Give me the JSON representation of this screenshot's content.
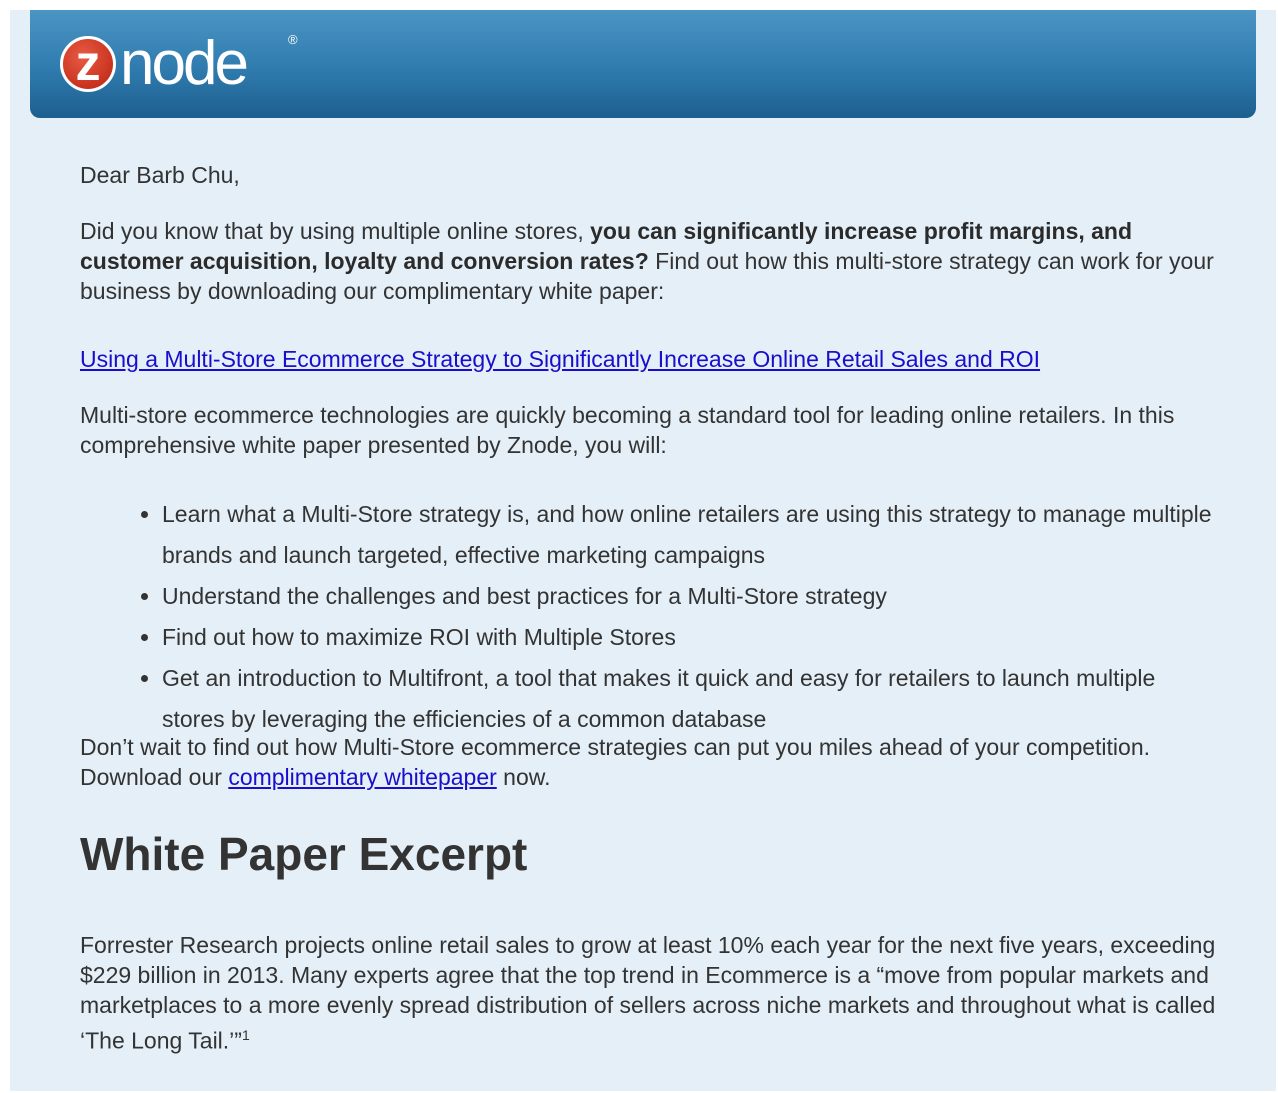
{
  "header": {
    "logo_letter": "z",
    "logo_text": "node",
    "logo_reg": "®"
  },
  "body": {
    "greeting": "Dear Barb Chu,",
    "intro_pre": "Did you know that by using multiple online stores, ",
    "intro_bold": "you can significantly increase profit margins, and customer acquisition, loyalty and conversion rates?",
    "intro_post": " Find out how this multi-store strategy can work for your business by downloading our complimentary white paper:",
    "whitepaper_link": "Using a Multi-Store Ecommerce Strategy to Significantly Increase Online Retail Sales and ROI",
    "paragraph2": "Multi-store ecommerce technologies are quickly becoming a standard tool for leading online retailers. In this comprehensive white paper presented by Znode, you will:",
    "bullets": [
      "Learn what a Multi-Store strategy is, and how online retailers are using this strategy to manage multiple brands and launch targeted, effective marketing campaigns",
      "Understand the challenges and best practices for a Multi-Store strategy",
      "Find out how to maximize ROI with Multiple Stores",
      "Get an introduction to Multifront, a tool that makes it quick and easy for retailers to launch multiple stores by leveraging the efficiencies of a common database"
    ],
    "closing_pre": "Don’t wait to find out how Multi-Store ecommerce strategies can put you miles ahead of your competition. Download our ",
    "closing_link": "complimentary whitepaper",
    "closing_post": " now.",
    "excerpt_heading": "White Paper Excerpt",
    "excerpt_text": "Forrester Research projects online retail sales to grow at least 10% each year for the next five years, exceeding $229 billion in 2013. Many experts agree that the top trend in Ecommerce is a “move from popular markets and marketplaces to a more evenly spread distribution of sellers across niche markets and throughout what is called ‘The Long Tail.’”",
    "footnote_mark": "1"
  },
  "colors": {
    "header_blue": "#2f7bae",
    "background": "#e4eff7",
    "link": "#1a0dcc",
    "logo_red": "#c8331f"
  }
}
